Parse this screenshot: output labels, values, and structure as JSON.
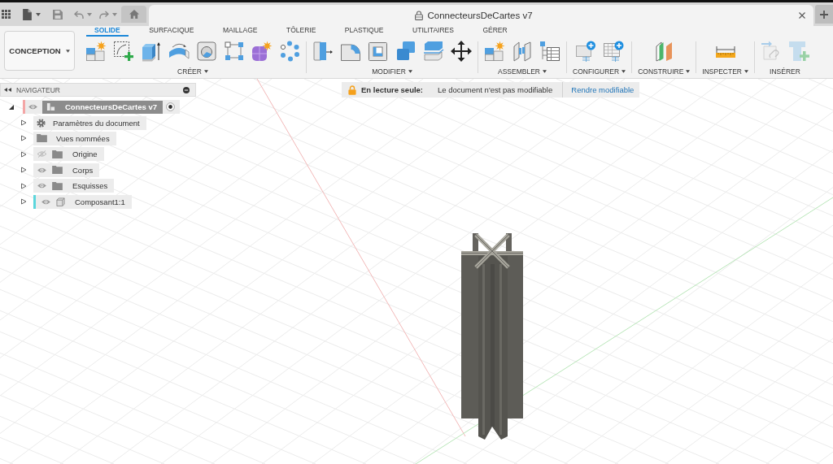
{
  "document_tab": {
    "title": "ConnecteursDeCartes v7",
    "locked": true
  },
  "workspace": {
    "label": "CONCEPTION"
  },
  "tabs": [
    {
      "label": "SOLIDE",
      "selected": true
    },
    {
      "label": "SURFACIQUE",
      "selected": false
    },
    {
      "label": "MAILLAGE",
      "selected": false
    },
    {
      "label": "TÔLERIE",
      "selected": false
    },
    {
      "label": "PLASTIQUE",
      "selected": false
    },
    {
      "label": "UTILITAIRES",
      "selected": false
    },
    {
      "label": "GÉRER",
      "selected": false
    }
  ],
  "tool_groups": [
    {
      "label": "CRÉER",
      "menu": true,
      "disabled": false
    },
    {
      "label": "MODIFIER",
      "menu": true,
      "disabled": false
    },
    {
      "label": "ASSEMBLER",
      "menu": true,
      "disabled": false
    },
    {
      "label": "CONFIGURER",
      "menu": true,
      "disabled": false
    },
    {
      "label": "CONSTRUIRE",
      "menu": true,
      "disabled": false
    },
    {
      "label": "INSPECTER",
      "menu": true,
      "disabled": false
    },
    {
      "label": "INSÉRER",
      "menu": false,
      "disabled": true
    }
  ],
  "navigator": {
    "title": "NAVIGATEUR",
    "items": [
      {
        "label": "ConnecteursDeCartes v7",
        "kind": "document",
        "expanded": true,
        "visible": true,
        "active": true,
        "color": "#f4a6a6",
        "children": [
          {
            "label": "Paramètres du document",
            "kind": "settings",
            "expanded": false
          },
          {
            "label": "Vues nommées",
            "kind": "views",
            "expanded": false
          },
          {
            "label": "Origine",
            "kind": "folder",
            "expanded": false,
            "visible": false
          },
          {
            "label": "Corps",
            "kind": "folder",
            "expanded": false,
            "visible": true
          },
          {
            "label": "Esquisses",
            "kind": "folder",
            "expanded": false,
            "visible": true
          },
          {
            "label": "Composant1:1",
            "kind": "component",
            "expanded": false,
            "visible": true,
            "color": "#5cd6dc"
          }
        ]
      }
    ]
  },
  "banner": {
    "label": "En lecture seule:",
    "message": "Le document n'est pas modifiable",
    "action": "Rendre modifiable"
  }
}
